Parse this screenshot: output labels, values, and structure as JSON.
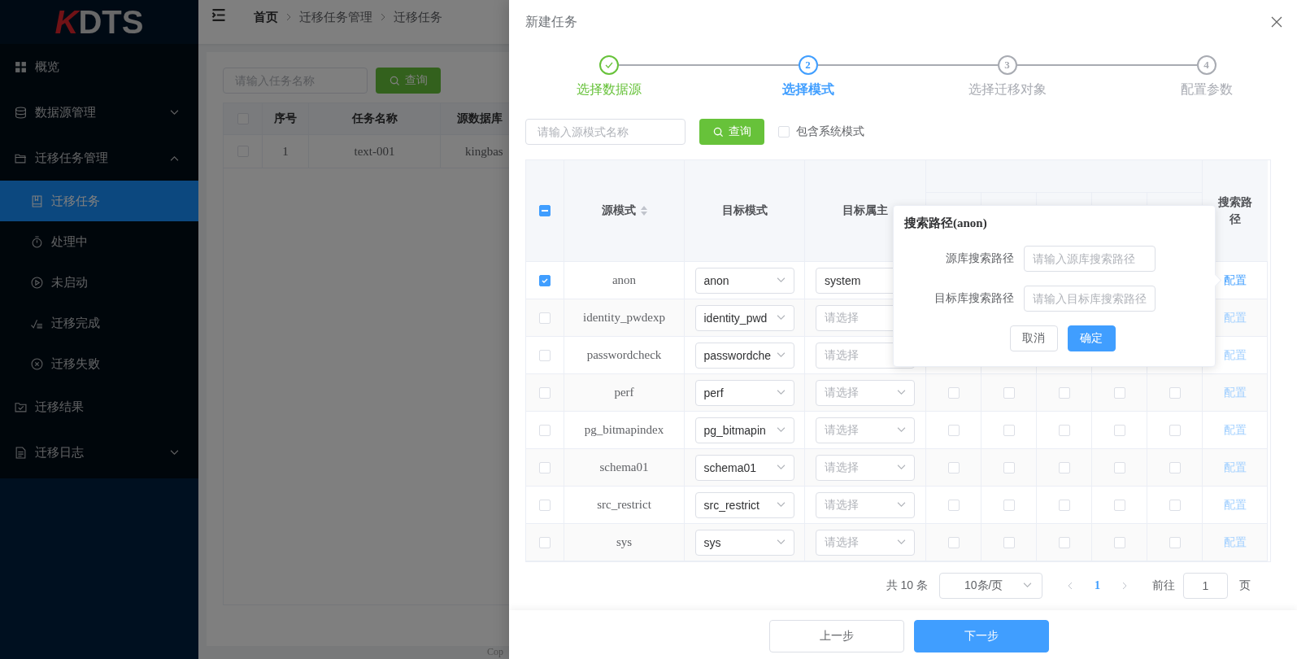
{
  "sidebar": {
    "logo": "KDTS",
    "items": [
      {
        "label": "概览",
        "selected": false
      },
      {
        "label": "数据源管理",
        "selected": false,
        "expanded": false
      },
      {
        "label": "迁移任务管理",
        "selected": false,
        "expanded": true,
        "children": [
          {
            "label": "迁移任务",
            "selected": true
          },
          {
            "label": "处理中",
            "selected": false
          },
          {
            "label": "未启动",
            "selected": false
          },
          {
            "label": "迁移完成",
            "selected": false
          },
          {
            "label": "迁移失败",
            "selected": false
          }
        ]
      },
      {
        "label": "迁移结果",
        "selected": false
      },
      {
        "label": "迁移日志",
        "selected": false,
        "expanded": false
      }
    ]
  },
  "header": {
    "breadcrumb": [
      "首页",
      "迁移任务管理",
      "迁移任务"
    ]
  },
  "task_list": {
    "search": {
      "placeholder": "请输入任务名称"
    },
    "search_button": "查询",
    "table": {
      "all_checked": false,
      "columns": [
        "序号",
        "任务名称",
        "源数据库"
      ],
      "rows": [
        {
          "checked": false,
          "cells": [
            "1",
            "text-001",
            "kingbas"
          ]
        }
      ]
    },
    "footer": "Cop"
  },
  "drawer": {
    "title": "新建任务",
    "steps": [
      {
        "label": "选择数据源",
        "completed": true,
        "selected": false
      },
      {
        "number": "2",
        "label": "选择模式",
        "completed": false,
        "selected": true
      },
      {
        "number": "3",
        "label": "选择迁移对象",
        "completed": false,
        "selected": false
      },
      {
        "number": "4",
        "label": "配置参数",
        "completed": false,
        "selected": false
      }
    ],
    "search": {
      "placeholder": "请输入源模式名称"
    },
    "search_button": "查询",
    "include_system": {
      "label": "包含系统模式",
      "checked": false
    },
    "table": {
      "select_all": {
        "indeterminate": true
      },
      "columns": [
        {
          "label": "源模式",
          "sortable": true
        },
        {
          "label": "目标模式",
          "sortable": false
        },
        {
          "label": "目标属主",
          "sortable": false
        },
        {
          "label": "搜索路径",
          "sortable": false
        }
      ],
      "rows": [
        {
          "checked": true,
          "source": "anon",
          "target": {
            "value": "anon"
          },
          "owner": {
            "value": "system"
          },
          "config": {
            "label": "配置",
            "disabled": false
          }
        },
        {
          "checked": false,
          "source": "identity_pwdexp",
          "target": {
            "value": "identity_pwd"
          },
          "owner": {
            "placeholder": "请选择"
          },
          "config": {
            "label": "配置",
            "disabled": true
          }
        },
        {
          "checked": false,
          "source": "passwordcheck",
          "target": {
            "value": "passwordche"
          },
          "owner": {
            "placeholder": "请选择"
          },
          "config": {
            "label": "配置",
            "disabled": true
          }
        },
        {
          "checked": false,
          "source": "perf",
          "target": {
            "value": "perf"
          },
          "owner": {
            "placeholder": "请选择"
          },
          "flags": [
            {
              "checked": false
            },
            {
              "checked": false
            },
            {
              "checked": false
            },
            {
              "checked": false
            },
            {
              "checked": false
            }
          ],
          "config": {
            "label": "配置",
            "disabled": true
          }
        },
        {
          "checked": false,
          "source": "pg_bitmapindex",
          "target": {
            "value": "pg_bitmapin"
          },
          "owner": {
            "placeholder": "请选择"
          },
          "flags": [
            {
              "checked": false
            },
            {
              "checked": false
            },
            {
              "checked": false
            },
            {
              "checked": false
            },
            {
              "checked": false
            }
          ],
          "config": {
            "label": "配置",
            "disabled": true
          }
        },
        {
          "checked": false,
          "source": "schema01",
          "target": {
            "value": "schema01"
          },
          "owner": {
            "placeholder": "请选择"
          },
          "flags": [
            {
              "checked": false
            },
            {
              "checked": false
            },
            {
              "checked": false
            },
            {
              "checked": false
            },
            {
              "checked": false
            }
          ],
          "config": {
            "label": "配置",
            "disabled": true
          }
        },
        {
          "checked": false,
          "source": "src_restrict",
          "target": {
            "value": "src_restrict"
          },
          "owner": {
            "placeholder": "请选择"
          },
          "flags": [
            {
              "checked": false
            },
            {
              "checked": false
            },
            {
              "checked": false
            },
            {
              "checked": false
            },
            {
              "checked": false
            }
          ],
          "config": {
            "label": "配置",
            "disabled": true
          }
        },
        {
          "checked": false,
          "source": "sys",
          "target": {
            "value": "sys"
          },
          "owner": {
            "placeholder": "请选择"
          },
          "flags": [
            {
              "checked": false
            },
            {
              "checked": false
            },
            {
              "checked": false
            },
            {
              "checked": false
            },
            {
              "checked": false
            }
          ],
          "config": {
            "label": "配置",
            "disabled": true
          }
        }
      ]
    },
    "popover": {
      "title": "搜索路径(anon)",
      "fields": [
        {
          "label": "源库搜索路径",
          "placeholder": "请输入源库搜索路径"
        },
        {
          "label": "目标库搜索路径",
          "placeholder": "请输入目标库搜索路径"
        }
      ],
      "buttons": [
        {
          "label": "取消",
          "kind": "default"
        },
        {
          "label": "确定",
          "kind": "primary"
        }
      ]
    },
    "pagination": {
      "total": "共 10 条",
      "page_size": "10条/页",
      "pages": [
        {
          "label": "1",
          "selected": true
        }
      ],
      "goto_label": "前往",
      "goto_value": "1",
      "page_suffix": "页"
    },
    "footer_buttons": [
      {
        "label": "上一步",
        "kind": "default"
      },
      {
        "label": "下一步",
        "kind": "primary"
      }
    ]
  }
}
